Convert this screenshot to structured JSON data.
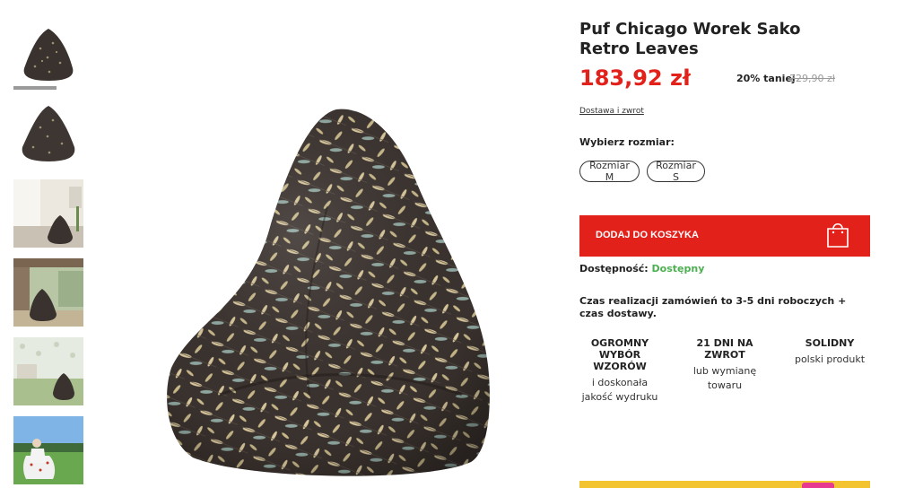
{
  "product": {
    "title": "Puf Chicago Worek Sako Retro Leaves",
    "price": "183,92 zł",
    "discount": "20% taniej",
    "old_price": "229,90 zł",
    "delivery_link": "Dostawa i zwrot"
  },
  "sizes": {
    "label": "Wybierz rozmiar:",
    "options": [
      "Rozmiar M",
      "Rozmiar S"
    ]
  },
  "cart": {
    "label": "DODAJ DO KOSZYKA",
    "icon": "shopping-bag-icon"
  },
  "availability": {
    "label": "Dostępność:",
    "value": "Dostępny",
    "value_color": "#4caf50"
  },
  "realization": "Czas realizacji zamówień to 3-5 dni roboczych + czas dostawy.",
  "features": [
    {
      "title": "OGROMNY WYBÓR WZORÓW",
      "subtitle": "i doskonała jakość wydruku"
    },
    {
      "title": "21 DNI NA ZWROT",
      "subtitle": "lub wymianę towaru"
    },
    {
      "title": "SOLIDNY",
      "subtitle": "polski produkt"
    }
  ],
  "colors": {
    "accent": "#e3211b",
    "available": "#4caf50",
    "fabric": "#3a322e"
  }
}
